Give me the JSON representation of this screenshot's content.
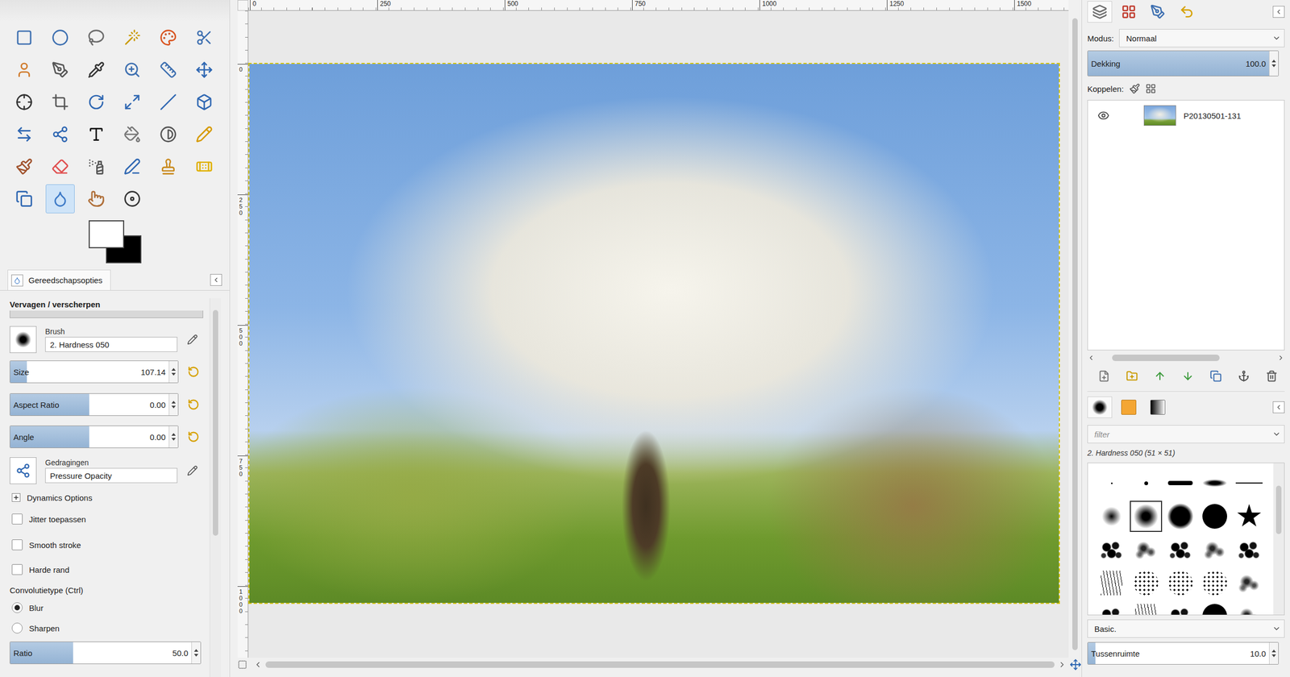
{
  "toolbox": {
    "tools": [
      {
        "kind": "rect-select",
        "selected": false
      },
      {
        "kind": "ellipse-select",
        "selected": false
      },
      {
        "kind": "free-select",
        "selected": false
      },
      {
        "kind": "fuzzy-select",
        "selected": false
      },
      {
        "kind": "color-select",
        "selected": false
      },
      {
        "kind": "scissors-select",
        "selected": false
      },
      {
        "kind": "foreground-select",
        "selected": false
      },
      {
        "kind": "paths",
        "selected": false
      },
      {
        "kind": "color-picker",
        "selected": false
      },
      {
        "kind": "zoom",
        "selected": false
      },
      {
        "kind": "measure",
        "selected": false
      },
      {
        "kind": "move",
        "selected": false
      },
      {
        "kind": "align",
        "selected": false
      },
      {
        "kind": "crop",
        "selected": false
      },
      {
        "kind": "rotate",
        "selected": false
      },
      {
        "kind": "scale",
        "selected": false
      },
      {
        "kind": "shear",
        "selected": false
      },
      {
        "kind": "perspective",
        "selected": false
      },
      {
        "kind": "flip",
        "selected": false
      },
      {
        "kind": "cage",
        "selected": false
      },
      {
        "kind": "text",
        "selected": false
      },
      {
        "kind": "bucket-fill",
        "selected": false
      },
      {
        "kind": "blend",
        "selected": false
      },
      {
        "kind": "pencil",
        "selected": false
      },
      {
        "kind": "paintbrush",
        "selected": false
      },
      {
        "kind": "eraser",
        "selected": false
      },
      {
        "kind": "airbrush",
        "selected": false
      },
      {
        "kind": "ink",
        "selected": false
      },
      {
        "kind": "clone",
        "selected": false
      },
      {
        "kind": "heal",
        "selected": false
      },
      {
        "kind": "perspective-clone",
        "selected": false
      },
      {
        "kind": "blur-sharpen",
        "selected": true
      },
      {
        "kind": "smudge",
        "selected": false
      },
      {
        "kind": "dodge-burn",
        "selected": false
      }
    ],
    "colors": {
      "foreground": "#ffffff",
      "background": "#000000"
    }
  },
  "tool_options": {
    "tab": "Gereedschapsopties",
    "title": "Vervagen / verscherpen",
    "brush": {
      "label": "Brush",
      "value": "2. Hardness 050"
    },
    "sliders": [
      {
        "label": "Size",
        "value": "107.14",
        "level": 0.1
      },
      {
        "label": "Aspect Ratio",
        "value": "0.00",
        "level": 0.47
      },
      {
        "label": "Angle",
        "value": "0.00",
        "level": 0.47
      }
    ],
    "dynamics": {
      "label": "Gedragingen",
      "value": "Pressure Opacity"
    },
    "expander": {
      "label": "Dynamics Options",
      "expanded": false
    },
    "checkboxes": [
      {
        "label": "Jitter toepassen",
        "checked": false
      },
      {
        "label": "Smooth stroke",
        "checked": false
      },
      {
        "label": "Harde rand",
        "checked": false
      }
    ],
    "convolve": {
      "label": "Convolutietype (Ctrl)",
      "options": [
        {
          "label": "Blur",
          "selected": true
        },
        {
          "label": "Sharpen",
          "selected": false
        }
      ]
    },
    "ratio": {
      "label": "Ratio",
      "value": "50.0",
      "level": 0.33
    }
  },
  "canvas": {
    "ruler_top": [
      "0",
      "250",
      "500",
      "750",
      "1000",
      "1250",
      "1500"
    ],
    "ruler_left": [
      "0",
      "250",
      "500",
      "750",
      "1000"
    ]
  },
  "layers": {
    "tabs": [
      {
        "kind": "layers",
        "selected": true
      },
      {
        "kind": "channels",
        "selected": false
      },
      {
        "kind": "paths",
        "selected": false
      },
      {
        "kind": "undo",
        "selected": false
      }
    ],
    "mode": {
      "label": "Modus:",
      "value": "Normaal"
    },
    "opacity": {
      "label": "Dekking",
      "value": "100.0",
      "level": 1
    },
    "lock_label": "Koppelen:",
    "items": [
      {
        "name": "P20130501-131",
        "visible": true,
        "selected": false
      }
    ],
    "buttons": [
      {
        "kind": "new"
      },
      {
        "kind": "group"
      },
      {
        "kind": "raise"
      },
      {
        "kind": "lower"
      },
      {
        "kind": "duplicate"
      },
      {
        "kind": "anchor"
      },
      {
        "kind": "delete"
      }
    ]
  },
  "brushes": {
    "tabs": [
      {
        "kind": "brushes",
        "selected": true
      },
      {
        "kind": "patterns",
        "selected": false
      },
      {
        "kind": "gradients",
        "selected": false
      }
    ],
    "filter_placeholder": "filter",
    "current": "2. Hardness 050 (51 × 51)",
    "items": [
      {
        "kind": "pixel",
        "selected": false
      },
      {
        "kind": "dot",
        "selected": false
      },
      {
        "kind": "bar",
        "selected": false
      },
      {
        "kind": "bar-soft",
        "selected": false
      },
      {
        "kind": "line",
        "selected": false
      },
      {
        "kind": "fuzzy-small",
        "selected": false
      },
      {
        "kind": "fuzzy",
        "selected": true
      },
      {
        "kind": "hard",
        "selected": false
      },
      {
        "kind": "solid",
        "selected": false
      },
      {
        "kind": "star",
        "selected": false
      },
      {
        "kind": "splat",
        "selected": false
      },
      {
        "kind": "splat-soft",
        "selected": false
      },
      {
        "kind": "splat",
        "selected": false
      },
      {
        "kind": "splat-soft",
        "selected": false
      },
      {
        "kind": "splat",
        "selected": false
      },
      {
        "kind": "grass",
        "selected": false
      },
      {
        "kind": "sparse",
        "selected": false
      },
      {
        "kind": "sparse",
        "selected": false
      },
      {
        "kind": "sparse",
        "selected": false
      },
      {
        "kind": "splat-soft",
        "selected": false
      },
      {
        "kind": "splat",
        "selected": false
      },
      {
        "kind": "grass",
        "selected": false
      },
      {
        "kind": "splat",
        "selected": false
      },
      {
        "kind": "solid",
        "selected": false
      },
      {
        "kind": "splat-soft",
        "selected": false
      }
    ],
    "preset": "Basic.",
    "spacing": {
      "label": "Tussenruimte",
      "value": "10.0",
      "level": 0.04
    }
  }
}
